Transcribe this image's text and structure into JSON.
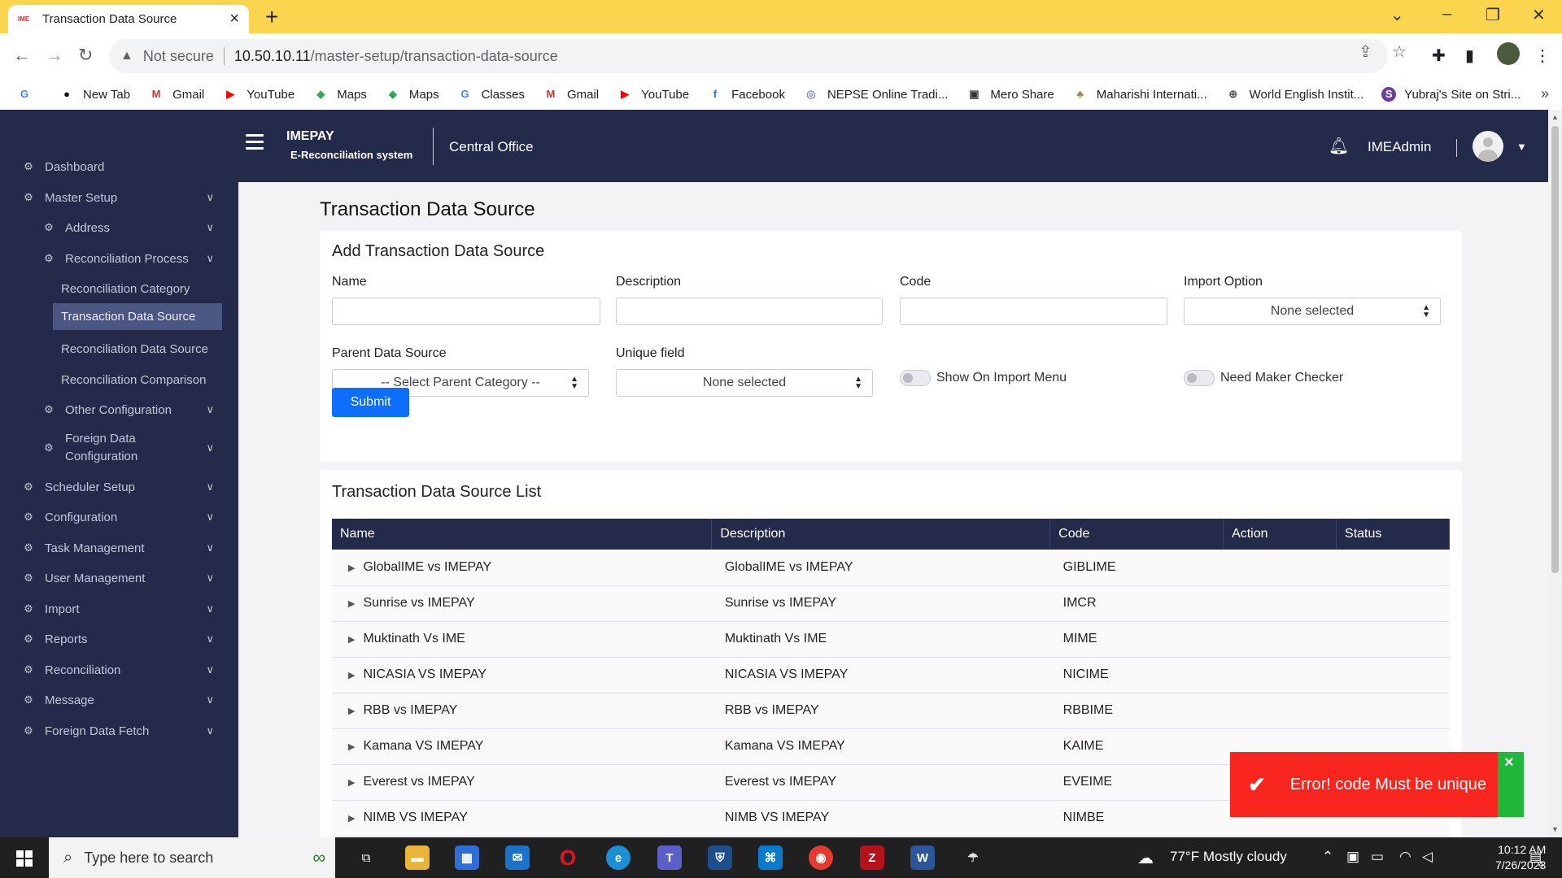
{
  "browser": {
    "tab_title": "Transaction Data Source",
    "tab_favicon": "imepay",
    "address_security": "Not secure",
    "address_host": "10.50.10.11",
    "address_path": "/master-setup/transaction-data-source",
    "bookmarks": [
      {
        "label": "New Tab",
        "icon": "github-icon"
      },
      {
        "label": "Gmail",
        "icon": "gmail-icon"
      },
      {
        "label": "YouTube",
        "icon": "youtube-icon"
      },
      {
        "label": "Maps",
        "icon": "maps-icon"
      },
      {
        "label": "Maps",
        "icon": "maps-icon"
      },
      {
        "label": "Classes",
        "icon": "google-icon"
      },
      {
        "label": "Gmail",
        "icon": "gmail-icon"
      },
      {
        "label": "YouTube",
        "icon": "youtube-icon"
      },
      {
        "label": "Facebook",
        "icon": "facebook-icon"
      },
      {
        "label": "NEPSE Online Tradi...",
        "icon": "nepse-icon"
      },
      {
        "label": "Mero Share",
        "icon": "meroshare-icon"
      },
      {
        "label": "Maharishi Internati...",
        "icon": "tree-icon"
      },
      {
        "label": "World English Instit...",
        "icon": "globe-icon"
      },
      {
        "label": "Yubraj's Site on Stri...",
        "icon": "site-icon"
      }
    ]
  },
  "header": {
    "brand_name": "IMEPAY",
    "brand_sub": "E-Reconciliation system",
    "office": "Central Office",
    "username": "IMEAdmin"
  },
  "sidebar": {
    "items": [
      {
        "label": "Dashboard",
        "level": 0,
        "has_children": false
      },
      {
        "label": "Master Setup",
        "level": 0,
        "has_children": true
      },
      {
        "label": "Address",
        "level": 1,
        "has_children": true
      },
      {
        "label": "Reconciliation Process",
        "level": 1,
        "has_children": true
      },
      {
        "label": "Reconciliation Category",
        "level": 2,
        "has_children": false
      },
      {
        "label": "Transaction Data Source",
        "level": 2,
        "has_children": false,
        "active": true
      },
      {
        "label": "Reconciliation Data Source",
        "level": 2,
        "has_children": false
      },
      {
        "label": "Reconciliation Comparison",
        "level": 2,
        "has_children": false
      },
      {
        "label": "Other Configuration",
        "level": 1,
        "has_children": true
      },
      {
        "label": "Foreign Data Configuration",
        "level": 1,
        "has_children": true
      },
      {
        "label": "Scheduler Setup",
        "level": 0,
        "has_children": true
      },
      {
        "label": "Configuration",
        "level": 0,
        "has_children": true
      },
      {
        "label": "Task Management",
        "level": 0,
        "has_children": true
      },
      {
        "label": "User Management",
        "level": 0,
        "has_children": true
      },
      {
        "label": "Import",
        "level": 0,
        "has_children": true
      },
      {
        "label": "Reports",
        "level": 0,
        "has_children": true
      },
      {
        "label": "Reconciliation",
        "level": 0,
        "has_children": true
      },
      {
        "label": "Message",
        "level": 0,
        "has_children": true
      },
      {
        "label": "Foreign Data Fetch",
        "level": 0,
        "has_children": true
      }
    ]
  },
  "page": {
    "title": "Transaction Data Source"
  },
  "form": {
    "title": "Add Transaction Data Source",
    "name_label": "Name",
    "name_value": "",
    "description_label": "Description",
    "description_value": "",
    "code_label": "Code",
    "code_value": "",
    "import_option_label": "Import Option",
    "import_option_value": "None selected",
    "parent_label": "Parent Data Source",
    "parent_value": "-- Select Parent Category --",
    "unique_label": "Unique field",
    "unique_value": "None selected",
    "show_import_label": "Show On Import Menu",
    "show_import_on": false,
    "maker_checker_label": "Need Maker Checker",
    "maker_checker_on": false,
    "submit_label": "Submit"
  },
  "list": {
    "title": "Transaction Data Source List",
    "columns": [
      "Name",
      "Description",
      "Code",
      "Action",
      "Status"
    ],
    "rows": [
      {
        "name": "GlobalIME vs IMEPAY",
        "description": "GlobalIME vs IMEPAY",
        "code": "GIBLIME"
      },
      {
        "name": "Sunrise vs IMEPAY",
        "description": "Sunrise vs IMEPAY",
        "code": "IMCR"
      },
      {
        "name": "Muktinath Vs IME",
        "description": "Muktinath Vs IME",
        "code": "MIME"
      },
      {
        "name": "NICASIA VS IMEPAY",
        "description": "NICASIA VS IMEPAY",
        "code": "NICIME"
      },
      {
        "name": "RBB vs IMEPAY",
        "description": "RBB vs IMEPAY",
        "code": "RBBIME"
      },
      {
        "name": "Kamana VS IMEPAY",
        "description": "Kamana VS IMEPAY",
        "code": "KAIME"
      },
      {
        "name": "Everest vs IMEPAY",
        "description": "Everest vs IMEPAY",
        "code": "EVEIME"
      },
      {
        "name": "NIMB VS IMEPAY",
        "description": "NIMB VS IMEPAY",
        "code": "NIMBE"
      }
    ]
  },
  "toast": {
    "message": "Error! code Must be unique",
    "icon": "check-icon"
  },
  "taskbar": {
    "search_placeholder": "Type here to search",
    "weather": "77°F  Mostly cloudy",
    "time": "10:12 AM",
    "date": "7/26/2023",
    "notification_count": "4"
  },
  "colors": {
    "navy": "#232a4a",
    "active_nav": "#4b5683",
    "primary": "#0d6efd",
    "toast_red": "#f8251e",
    "toast_green": "#1fb83a",
    "chrome_yellow": "#fbd54e"
  }
}
